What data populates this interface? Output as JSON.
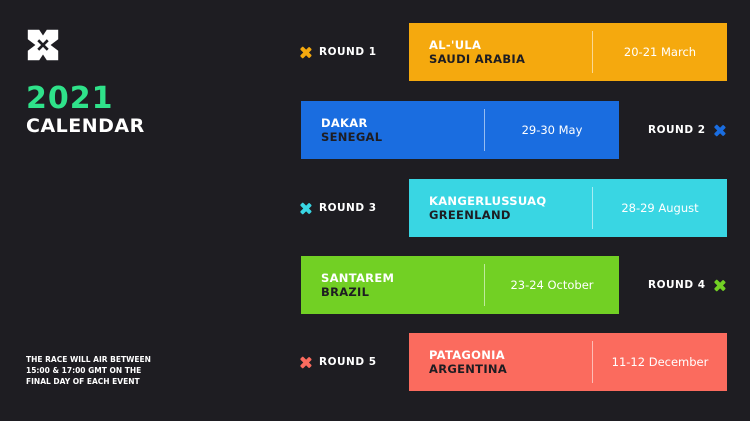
{
  "header": {
    "year": "2021",
    "title": "CALENDAR"
  },
  "note": "THE RACE WILL AIR BETWEEN 15:00 & 17:00 GMT ON THE FINAL DAY OF EACH EVENT",
  "rounds": [
    {
      "label": "ROUND 1",
      "city": "AL-'ULA",
      "country": "SAUDI ARABIA",
      "date": "20-21 March",
      "color": "#f5a90e",
      "country_color": "#1e1d22",
      "city_color": "#ffffff"
    },
    {
      "label": "ROUND 2",
      "city": "DAKAR",
      "country": "SENEGAL",
      "date": "29-30 May",
      "color": "#1a6de0",
      "country_color": "#1e1d22",
      "city_color": "#ffffff"
    },
    {
      "label": "ROUND 3",
      "city": "KANGERLUSSUAQ",
      "country": "GREENLAND",
      "date": "28-29 August",
      "color": "#39d6e3",
      "country_color": "#1e1d22",
      "city_color": "#ffffff"
    },
    {
      "label": "ROUND 4",
      "city": "SANTAREM",
      "country": "BRAZIL",
      "date": "23-24 October",
      "color": "#72d024",
      "country_color": "#1e1d22",
      "city_color": "#ffffff"
    },
    {
      "label": "ROUND 5",
      "city": "PATAGONIA",
      "country": "ARGENTINA",
      "date": "11-12 December",
      "color": "#fb6b5e",
      "country_color": "#1e1d22",
      "city_color": "#ffffff"
    }
  ],
  "colors": {
    "background": "#1e1d22",
    "year_accent": "#2fe28a"
  }
}
